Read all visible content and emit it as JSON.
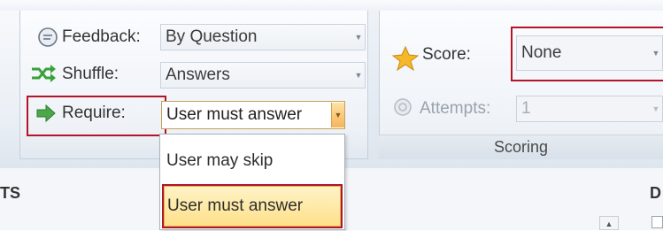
{
  "feedback": {
    "label": "Feedback:",
    "value": "By Question"
  },
  "shuffle": {
    "label": "Shuffle:",
    "value": "Answers"
  },
  "require": {
    "label": "Require:",
    "value": "User must answer",
    "options": [
      "User may skip",
      "User must answer"
    ],
    "selected": "User must answer"
  },
  "score": {
    "label": "Score:",
    "value": "None"
  },
  "attempts": {
    "label": "Attempts:",
    "value": "1"
  },
  "scoring_group": {
    "caption": "Scoring"
  },
  "sections": {
    "left_heading": "TS",
    "right_heading": "D"
  },
  "colors": {
    "highlight_border": "#b3142a",
    "selected_item": "#fde08a",
    "shuffle_icon": "#3aa13a",
    "require_icon": "#4aa84a",
    "star_icon": "#f5b82a"
  }
}
